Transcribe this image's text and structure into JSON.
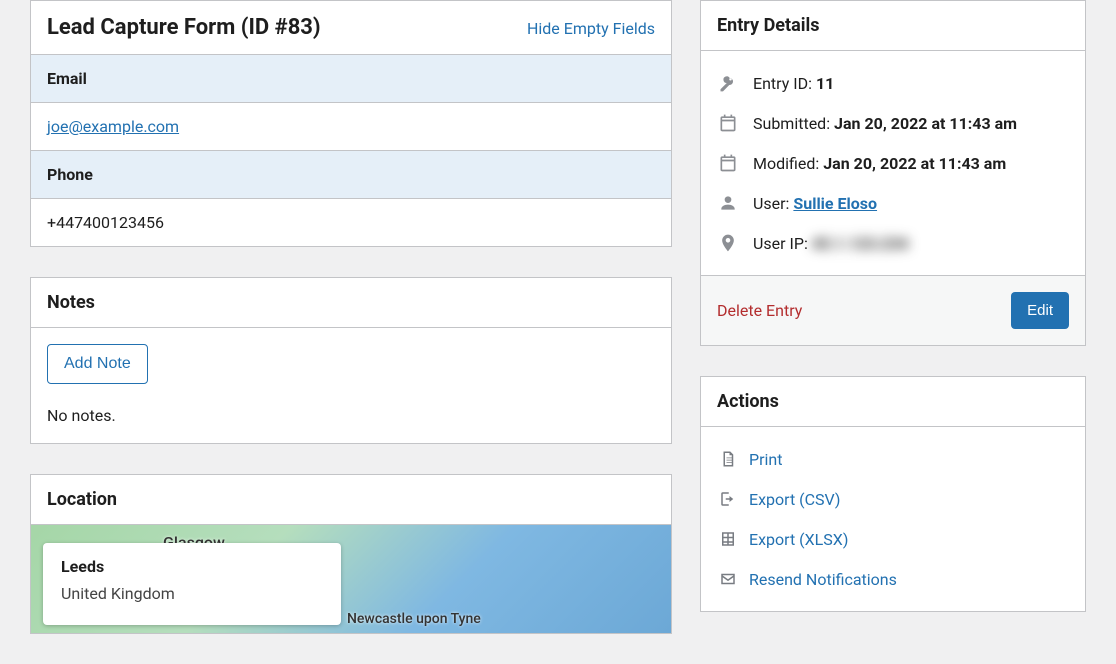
{
  "form": {
    "title": "Lead Capture Form (ID #83)",
    "hide_empty_label": "Hide Empty Fields",
    "fields": {
      "email_label": "Email",
      "email_value": "joe@example.com",
      "phone_label": "Phone",
      "phone_value": "+447400123456"
    }
  },
  "notes": {
    "title": "Notes",
    "add_note_label": "Add Note",
    "no_notes": "No notes."
  },
  "location": {
    "title": "Location",
    "place_title": "Leeds",
    "place_country": "United Kingdom",
    "map_labels": {
      "glasgow": "Glasgow",
      "newcastle": "Newcastle upon Tyne"
    }
  },
  "entry_details": {
    "title": "Entry Details",
    "entry_id_label": "Entry ID:",
    "entry_id_value": "11",
    "submitted_label": "Submitted:",
    "submitted_value": "Jan 20, 2022 at 11:43 am",
    "modified_label": "Modified:",
    "modified_value": "Jan 20, 2022 at 11:43 am",
    "user_label": "User:",
    "user_value": "Sullie Eloso",
    "user_ip_label": "User IP:",
    "user_ip_value": "45.1.123.234",
    "delete_label": "Delete Entry",
    "edit_label": "Edit"
  },
  "actions": {
    "title": "Actions",
    "print_label": "Print",
    "export_csv_label": "Export (CSV)",
    "export_xlsx_label": "Export (XLSX)",
    "resend_label": "Resend Notifications"
  }
}
